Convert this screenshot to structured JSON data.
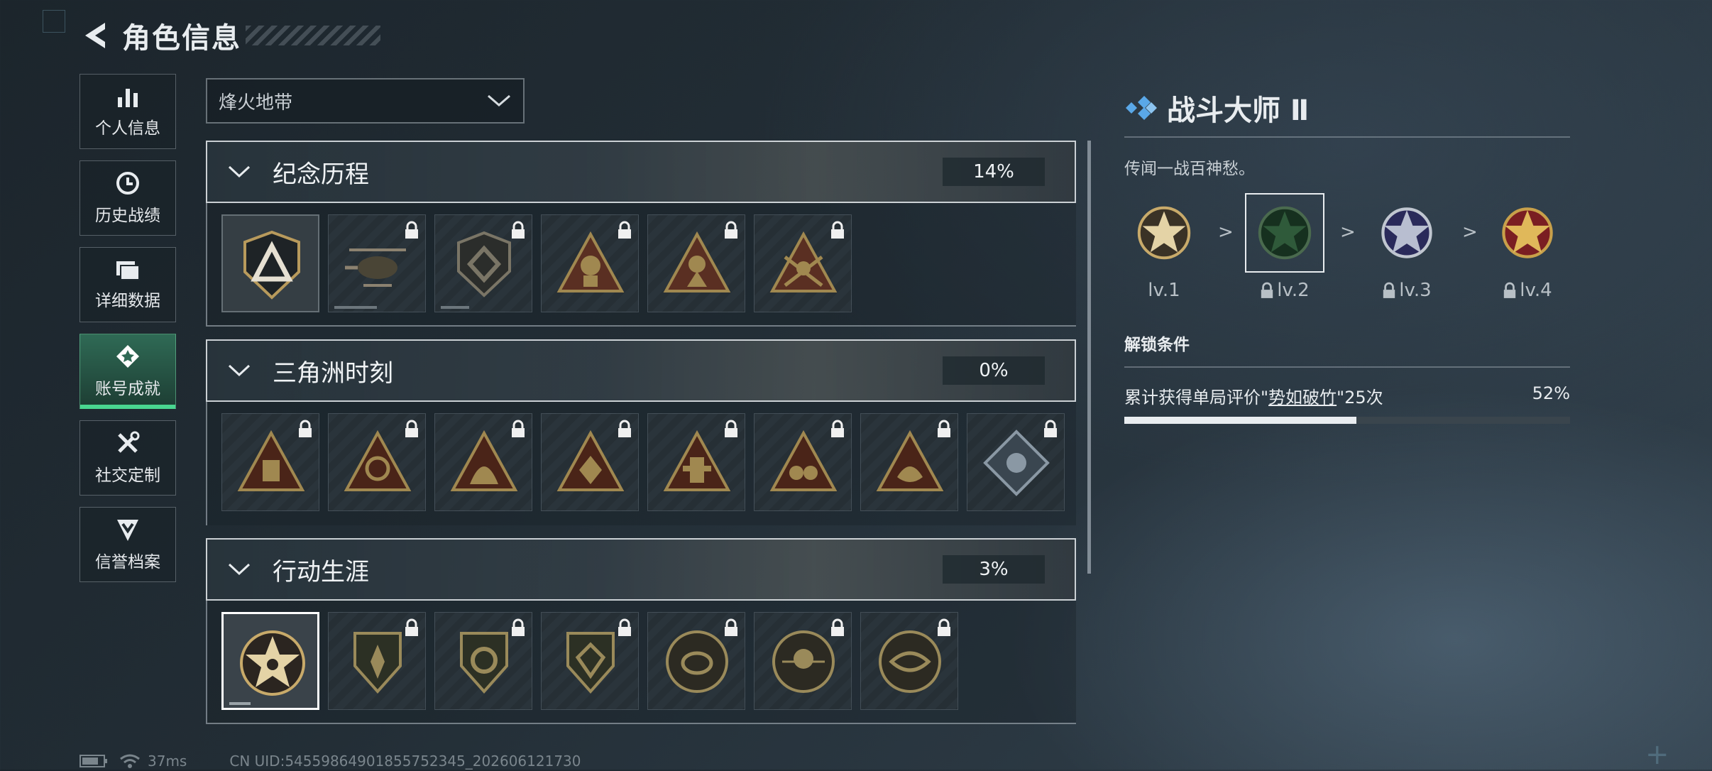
{
  "header": {
    "title": "角色信息"
  },
  "sidebar": {
    "items": [
      {
        "label": "个人信息",
        "icon": "bar-chart-icon"
      },
      {
        "label": "历史战绩",
        "icon": "history-icon"
      },
      {
        "label": "详细数据",
        "icon": "folder-icon"
      },
      {
        "label": "账号成就",
        "icon": "achievement-icon",
        "active": true
      },
      {
        "label": "社交定制",
        "icon": "tools-icon"
      },
      {
        "label": "信誉档案",
        "icon": "shield-icon"
      }
    ]
  },
  "mode_select": {
    "value": "烽火地带"
  },
  "sections": [
    {
      "name": "纪念历程",
      "percent": "14%"
    },
    {
      "name": "三角洲时刻",
      "percent": "0%"
    },
    {
      "name": "行动生涯",
      "percent": "3%"
    }
  ],
  "detail": {
    "title": "战斗大师 Ⅱ",
    "description": "传闻一战百神愁。",
    "levels": [
      "lv.1",
      "lv.2",
      "lv.3",
      "lv.4"
    ],
    "separator": ">",
    "unlock_title": "解锁条件",
    "condition_prefix": "累计获得单局评价\"",
    "condition_highlight": "势如破竹",
    "condition_suffix": "\"25次",
    "progress_text": "52%",
    "progress": 0.52
  },
  "status": {
    "ping": "37ms",
    "uid": "CN UID:54559864901855752345_202606121730"
  },
  "colors": {
    "accent_green": "#49d690",
    "gold": "#b89a5c",
    "icon_blue": "#5aa8e8"
  }
}
